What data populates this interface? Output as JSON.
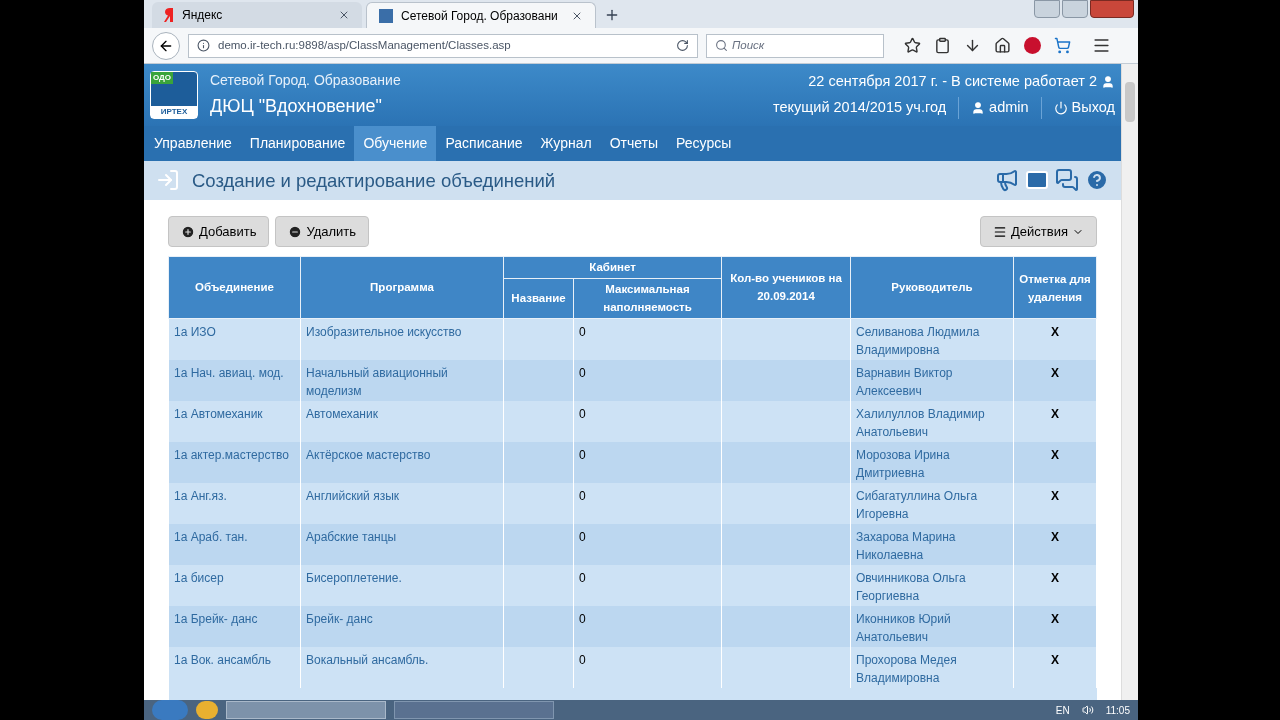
{
  "browser": {
    "tabs": [
      {
        "label": "Яндекс",
        "selected": false
      },
      {
        "label": "Сетевой Город. Образовани",
        "selected": true
      }
    ],
    "url": "demo.ir-tech.ru:9898/asp/ClassManagement/Classes.asp",
    "search_placeholder": "Поиск"
  },
  "header": {
    "logo_badge": "ОДО",
    "logo_text": "ИРТЕХ",
    "system": "Сетевой Город. Образование",
    "org": "ДЮЦ \"Вдохновение\"",
    "date_line": "22 сентября 2017 г. - В системе работает 2",
    "year": "текущий 2014/2015 уч.год",
    "user": "admin",
    "logout": "Выход"
  },
  "nav": [
    {
      "label": "Управление",
      "selected": false
    },
    {
      "label": "Планирование",
      "selected": false
    },
    {
      "label": "Обучение",
      "selected": true
    },
    {
      "label": "Расписание",
      "selected": false
    },
    {
      "label": "Журнал",
      "selected": false
    },
    {
      "label": "Отчеты",
      "selected": false
    },
    {
      "label": "Ресурсы",
      "selected": false
    }
  ],
  "page_title": "Создание и редактирование объединений",
  "buttons": {
    "add": "Добавить",
    "delete": "Удалить",
    "actions": "Действия"
  },
  "table": {
    "columns": {
      "group": "Объединение",
      "program": "Программа",
      "room": "Кабинет",
      "room_name": "Название",
      "capacity": "Максимальная наполняемость",
      "students": "Кол-во учеников на 20.09.2014",
      "leader": "Руководитель",
      "delete_mark": "Отметка для удаления"
    },
    "rows": [
      {
        "group": "1а ИЗО",
        "program": "Изобразительное искусство",
        "capacity": "0",
        "leader": "Селиванова Людмила Владимировна",
        "mark": "X"
      },
      {
        "group": "1а Нач. авиац. мод.",
        "program": "Начальный авиационный моделизм",
        "capacity": "0",
        "leader": "Варнавин Виктор Алексеевич",
        "mark": "X"
      },
      {
        "group": "1а Автомеханик",
        "program": "Автомеханик",
        "capacity": "0",
        "leader": "Халилуллов Владимир Анатольевич",
        "mark": "X"
      },
      {
        "group": "1а актер.мастерство",
        "program": "Актёрское мастерство",
        "capacity": "0",
        "leader": "Морозова Ирина Дмитриевна",
        "mark": "X"
      },
      {
        "group": "1а Анг.яз.",
        "program": "Английский язык",
        "capacity": "0",
        "leader": "Сибагатуллина Ольга Игоревна",
        "mark": "X"
      },
      {
        "group": "1а Араб. тан.",
        "program": "Арабские танцы",
        "capacity": "0",
        "leader": "Захарова Марина Николаевна",
        "mark": "X"
      },
      {
        "group": "1а бисер",
        "program": "Бисероплетение.",
        "capacity": "0",
        "leader": "Овчинникова Ольга Георгиевна",
        "mark": "X"
      },
      {
        "group": "1а Брейк- данс",
        "program": "Брейк- данс",
        "capacity": "0",
        "leader": "Иконников Юрий Анатольевич",
        "mark": "X"
      },
      {
        "group": "1а Вок. ансамбль",
        "program": "Вокальный ансамбль.",
        "capacity": "0",
        "leader": "Прохорова Медея Владимировна",
        "mark": "X"
      }
    ]
  },
  "taskbar": {
    "lang": "EN",
    "time": "11:05"
  }
}
